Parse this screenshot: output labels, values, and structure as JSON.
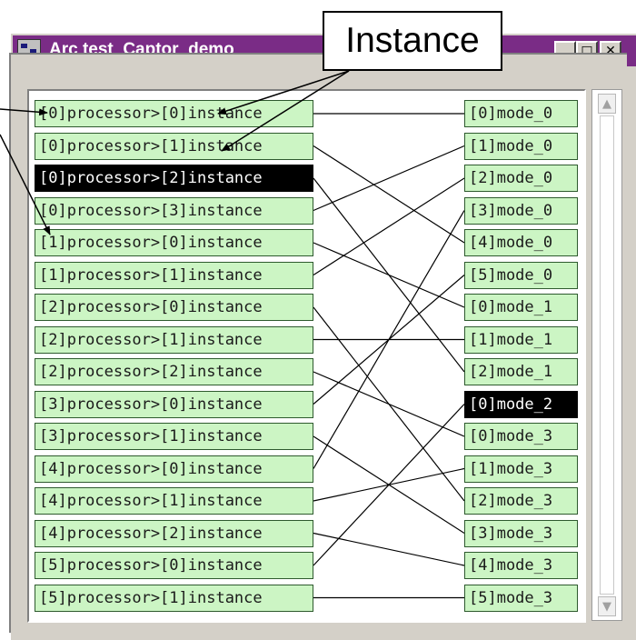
{
  "window": {
    "title": "Arc test_Captor_demo",
    "controls": {
      "minimize_glyph": "_",
      "maximize_glyph": "□",
      "close_glyph": "✕"
    }
  },
  "callout": {
    "label": "Instance"
  },
  "left_items": [
    "[0]processor>[0]instance",
    "[0]processor>[1]instance",
    "[0]processor>[2]instance",
    "[0]processor>[3]instance",
    "[1]processor>[0]instance",
    "[1]processor>[1]instance",
    "[2]processor>[0]instance",
    "[2]processor>[1]instance",
    "[2]processor>[2]instance",
    "[3]processor>[0]instance",
    "[3]processor>[1]instance",
    "[4]processor>[0]instance",
    "[4]processor>[1]instance",
    "[4]processor>[2]instance",
    "[5]processor>[0]instance",
    "[5]processor>[1]instance"
  ],
  "right_items": [
    "[0]mode_0",
    "[1]mode_0",
    "[2]mode_0",
    "[3]mode_0",
    "[4]mode_0",
    "[5]mode_0",
    "[0]mode_1",
    "[1]mode_1",
    "[2]mode_1",
    "[0]mode_2",
    "[0]mode_3",
    "[1]mode_3",
    "[2]mode_3",
    "[3]mode_3",
    "[4]mode_3",
    "[5]mode_3"
  ],
  "selected_left_index": 2,
  "selected_right_index": 9,
  "connections": [
    [
      0,
      0
    ],
    [
      1,
      4
    ],
    [
      2,
      8
    ],
    [
      3,
      1
    ],
    [
      4,
      6
    ],
    [
      5,
      2
    ],
    [
      6,
      12
    ],
    [
      7,
      7
    ],
    [
      8,
      10
    ],
    [
      9,
      5
    ],
    [
      10,
      13
    ],
    [
      11,
      3
    ],
    [
      12,
      11
    ],
    [
      13,
      14
    ],
    [
      14,
      9
    ],
    [
      15,
      15
    ]
  ],
  "scrollbar": {
    "up_glyph": "▲",
    "down_glyph": "▼"
  },
  "colors": {
    "title_bar": "#7a2c86",
    "item_fill": "#ccf5c4",
    "item_border": "#2e5a2e",
    "selected_fill": "#000000",
    "selected_text": "#ffffff",
    "window_face": "#d4d0c8"
  }
}
